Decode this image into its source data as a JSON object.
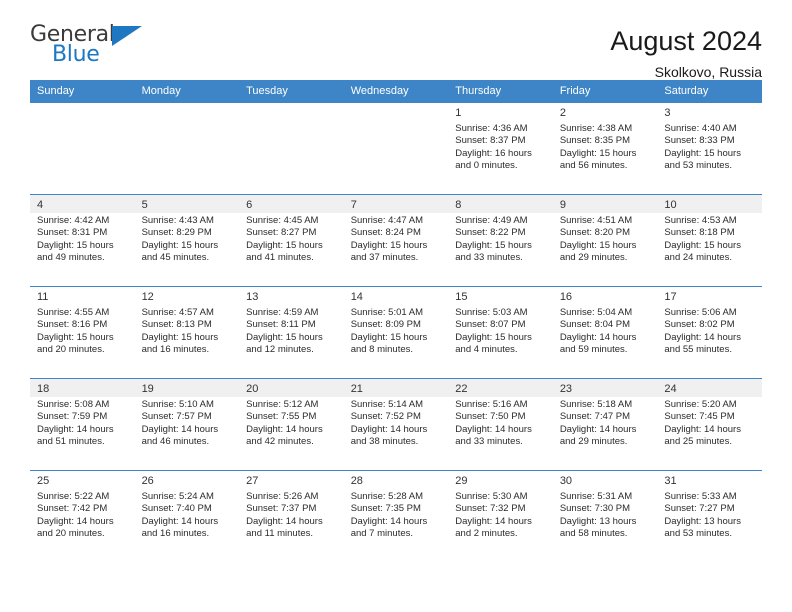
{
  "brand": {
    "word1": "General",
    "word2": "Blue",
    "flag_icon": "triangle-flag-icon",
    "accent_color": "#1d78c1"
  },
  "header": {
    "title": "August 2024",
    "location": "Skolkovo, Russia"
  },
  "theme": {
    "header_bg": "#3d85c6",
    "header_text": "#ffffff",
    "row_shade": "#f4f4f4",
    "cell_border": "#3d85c6"
  },
  "calendar": {
    "weekday_headers": [
      "Sunday",
      "Monday",
      "Tuesday",
      "Wednesday",
      "Thursday",
      "Friday",
      "Saturday"
    ],
    "weeks": [
      {
        "shaded": false,
        "days": [
          {
            "empty": true
          },
          {
            "empty": true
          },
          {
            "empty": true
          },
          {
            "empty": true
          },
          {
            "day": "1",
            "sunrise": "Sunrise: 4:36 AM",
            "sunset": "Sunset: 8:37 PM",
            "daylight1": "Daylight: 16 hours",
            "daylight2": "and 0 minutes."
          },
          {
            "day": "2",
            "sunrise": "Sunrise: 4:38 AM",
            "sunset": "Sunset: 8:35 PM",
            "daylight1": "Daylight: 15 hours",
            "daylight2": "and 56 minutes."
          },
          {
            "day": "3",
            "sunrise": "Sunrise: 4:40 AM",
            "sunset": "Sunset: 8:33 PM",
            "daylight1": "Daylight: 15 hours",
            "daylight2": "and 53 minutes."
          }
        ]
      },
      {
        "shaded": true,
        "days": [
          {
            "day": "4",
            "sunrise": "Sunrise: 4:42 AM",
            "sunset": "Sunset: 8:31 PM",
            "daylight1": "Daylight: 15 hours",
            "daylight2": "and 49 minutes."
          },
          {
            "day": "5",
            "sunrise": "Sunrise: 4:43 AM",
            "sunset": "Sunset: 8:29 PM",
            "daylight1": "Daylight: 15 hours",
            "daylight2": "and 45 minutes."
          },
          {
            "day": "6",
            "sunrise": "Sunrise: 4:45 AM",
            "sunset": "Sunset: 8:27 PM",
            "daylight1": "Daylight: 15 hours",
            "daylight2": "and 41 minutes."
          },
          {
            "day": "7",
            "sunrise": "Sunrise: 4:47 AM",
            "sunset": "Sunset: 8:24 PM",
            "daylight1": "Daylight: 15 hours",
            "daylight2": "and 37 minutes."
          },
          {
            "day": "8",
            "sunrise": "Sunrise: 4:49 AM",
            "sunset": "Sunset: 8:22 PM",
            "daylight1": "Daylight: 15 hours",
            "daylight2": "and 33 minutes."
          },
          {
            "day": "9",
            "sunrise": "Sunrise: 4:51 AM",
            "sunset": "Sunset: 8:20 PM",
            "daylight1": "Daylight: 15 hours",
            "daylight2": "and 29 minutes."
          },
          {
            "day": "10",
            "sunrise": "Sunrise: 4:53 AM",
            "sunset": "Sunset: 8:18 PM",
            "daylight1": "Daylight: 15 hours",
            "daylight2": "and 24 minutes."
          }
        ]
      },
      {
        "shaded": false,
        "days": [
          {
            "day": "11",
            "sunrise": "Sunrise: 4:55 AM",
            "sunset": "Sunset: 8:16 PM",
            "daylight1": "Daylight: 15 hours",
            "daylight2": "and 20 minutes."
          },
          {
            "day": "12",
            "sunrise": "Sunrise: 4:57 AM",
            "sunset": "Sunset: 8:13 PM",
            "daylight1": "Daylight: 15 hours",
            "daylight2": "and 16 minutes."
          },
          {
            "day": "13",
            "sunrise": "Sunrise: 4:59 AM",
            "sunset": "Sunset: 8:11 PM",
            "daylight1": "Daylight: 15 hours",
            "daylight2": "and 12 minutes."
          },
          {
            "day": "14",
            "sunrise": "Sunrise: 5:01 AM",
            "sunset": "Sunset: 8:09 PM",
            "daylight1": "Daylight: 15 hours",
            "daylight2": "and 8 minutes."
          },
          {
            "day": "15",
            "sunrise": "Sunrise: 5:03 AM",
            "sunset": "Sunset: 8:07 PM",
            "daylight1": "Daylight: 15 hours",
            "daylight2": "and 4 minutes."
          },
          {
            "day": "16",
            "sunrise": "Sunrise: 5:04 AM",
            "sunset": "Sunset: 8:04 PM",
            "daylight1": "Daylight: 14 hours",
            "daylight2": "and 59 minutes."
          },
          {
            "day": "17",
            "sunrise": "Sunrise: 5:06 AM",
            "sunset": "Sunset: 8:02 PM",
            "daylight1": "Daylight: 14 hours",
            "daylight2": "and 55 minutes."
          }
        ]
      },
      {
        "shaded": true,
        "days": [
          {
            "day": "18",
            "sunrise": "Sunrise: 5:08 AM",
            "sunset": "Sunset: 7:59 PM",
            "daylight1": "Daylight: 14 hours",
            "daylight2": "and 51 minutes."
          },
          {
            "day": "19",
            "sunrise": "Sunrise: 5:10 AM",
            "sunset": "Sunset: 7:57 PM",
            "daylight1": "Daylight: 14 hours",
            "daylight2": "and 46 minutes."
          },
          {
            "day": "20",
            "sunrise": "Sunrise: 5:12 AM",
            "sunset": "Sunset: 7:55 PM",
            "daylight1": "Daylight: 14 hours",
            "daylight2": "and 42 minutes."
          },
          {
            "day": "21",
            "sunrise": "Sunrise: 5:14 AM",
            "sunset": "Sunset: 7:52 PM",
            "daylight1": "Daylight: 14 hours",
            "daylight2": "and 38 minutes."
          },
          {
            "day": "22",
            "sunrise": "Sunrise: 5:16 AM",
            "sunset": "Sunset: 7:50 PM",
            "daylight1": "Daylight: 14 hours",
            "daylight2": "and 33 minutes."
          },
          {
            "day": "23",
            "sunrise": "Sunrise: 5:18 AM",
            "sunset": "Sunset: 7:47 PM",
            "daylight1": "Daylight: 14 hours",
            "daylight2": "and 29 minutes."
          },
          {
            "day": "24",
            "sunrise": "Sunrise: 5:20 AM",
            "sunset": "Sunset: 7:45 PM",
            "daylight1": "Daylight: 14 hours",
            "daylight2": "and 25 minutes."
          }
        ]
      },
      {
        "shaded": false,
        "days": [
          {
            "day": "25",
            "sunrise": "Sunrise: 5:22 AM",
            "sunset": "Sunset: 7:42 PM",
            "daylight1": "Daylight: 14 hours",
            "daylight2": "and 20 minutes."
          },
          {
            "day": "26",
            "sunrise": "Sunrise: 5:24 AM",
            "sunset": "Sunset: 7:40 PM",
            "daylight1": "Daylight: 14 hours",
            "daylight2": "and 16 minutes."
          },
          {
            "day": "27",
            "sunrise": "Sunrise: 5:26 AM",
            "sunset": "Sunset: 7:37 PM",
            "daylight1": "Daylight: 14 hours",
            "daylight2": "and 11 minutes."
          },
          {
            "day": "28",
            "sunrise": "Sunrise: 5:28 AM",
            "sunset": "Sunset: 7:35 PM",
            "daylight1": "Daylight: 14 hours",
            "daylight2": "and 7 minutes."
          },
          {
            "day": "29",
            "sunrise": "Sunrise: 5:30 AM",
            "sunset": "Sunset: 7:32 PM",
            "daylight1": "Daylight: 14 hours",
            "daylight2": "and 2 minutes."
          },
          {
            "day": "30",
            "sunrise": "Sunrise: 5:31 AM",
            "sunset": "Sunset: 7:30 PM",
            "daylight1": "Daylight: 13 hours",
            "daylight2": "and 58 minutes."
          },
          {
            "day": "31",
            "sunrise": "Sunrise: 5:33 AM",
            "sunset": "Sunset: 7:27 PM",
            "daylight1": "Daylight: 13 hours",
            "daylight2": "and 53 minutes."
          }
        ]
      }
    ]
  }
}
